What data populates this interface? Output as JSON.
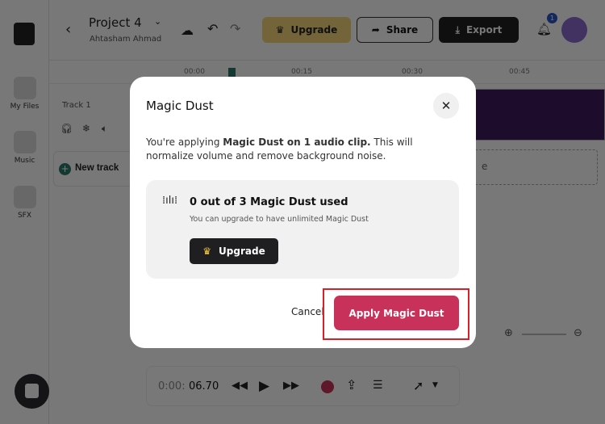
{
  "header": {
    "project_title": "Project 4",
    "owner": "Ahtasham Ahmad",
    "upgrade": "Upgrade",
    "share": "Share",
    "export": "Export",
    "notification_count": "1"
  },
  "sidebar": {
    "items": [
      {
        "label": "My Files"
      },
      {
        "label": "Music"
      },
      {
        "label": "SFX"
      }
    ]
  },
  "timeline": {
    "ticks": [
      "00:00",
      "00:15",
      "00:30",
      "00:45"
    ]
  },
  "track": {
    "name": "Track 1",
    "new_track": "New track",
    "drop_hint": "e"
  },
  "player": {
    "time_prefix": "0:00:",
    "time": "06.70"
  },
  "modal": {
    "title": "Magic Dust",
    "desc_prefix": "You're applying ",
    "desc_bold": "Magic Dust on 1 audio clip.",
    "desc_suffix": " This will normalize volume and remove background noise.",
    "usage_title": "0 out of 3 Magic Dust used",
    "usage_sub": "You can upgrade to have unlimited Magic Dust",
    "upgrade": "Upgrade",
    "cancel": "Cancel",
    "apply": "Apply Magic Dust"
  },
  "colors": {
    "accent": "#c8325a",
    "highlight": "#d81f2a",
    "waveform": "#3d1a5c"
  }
}
